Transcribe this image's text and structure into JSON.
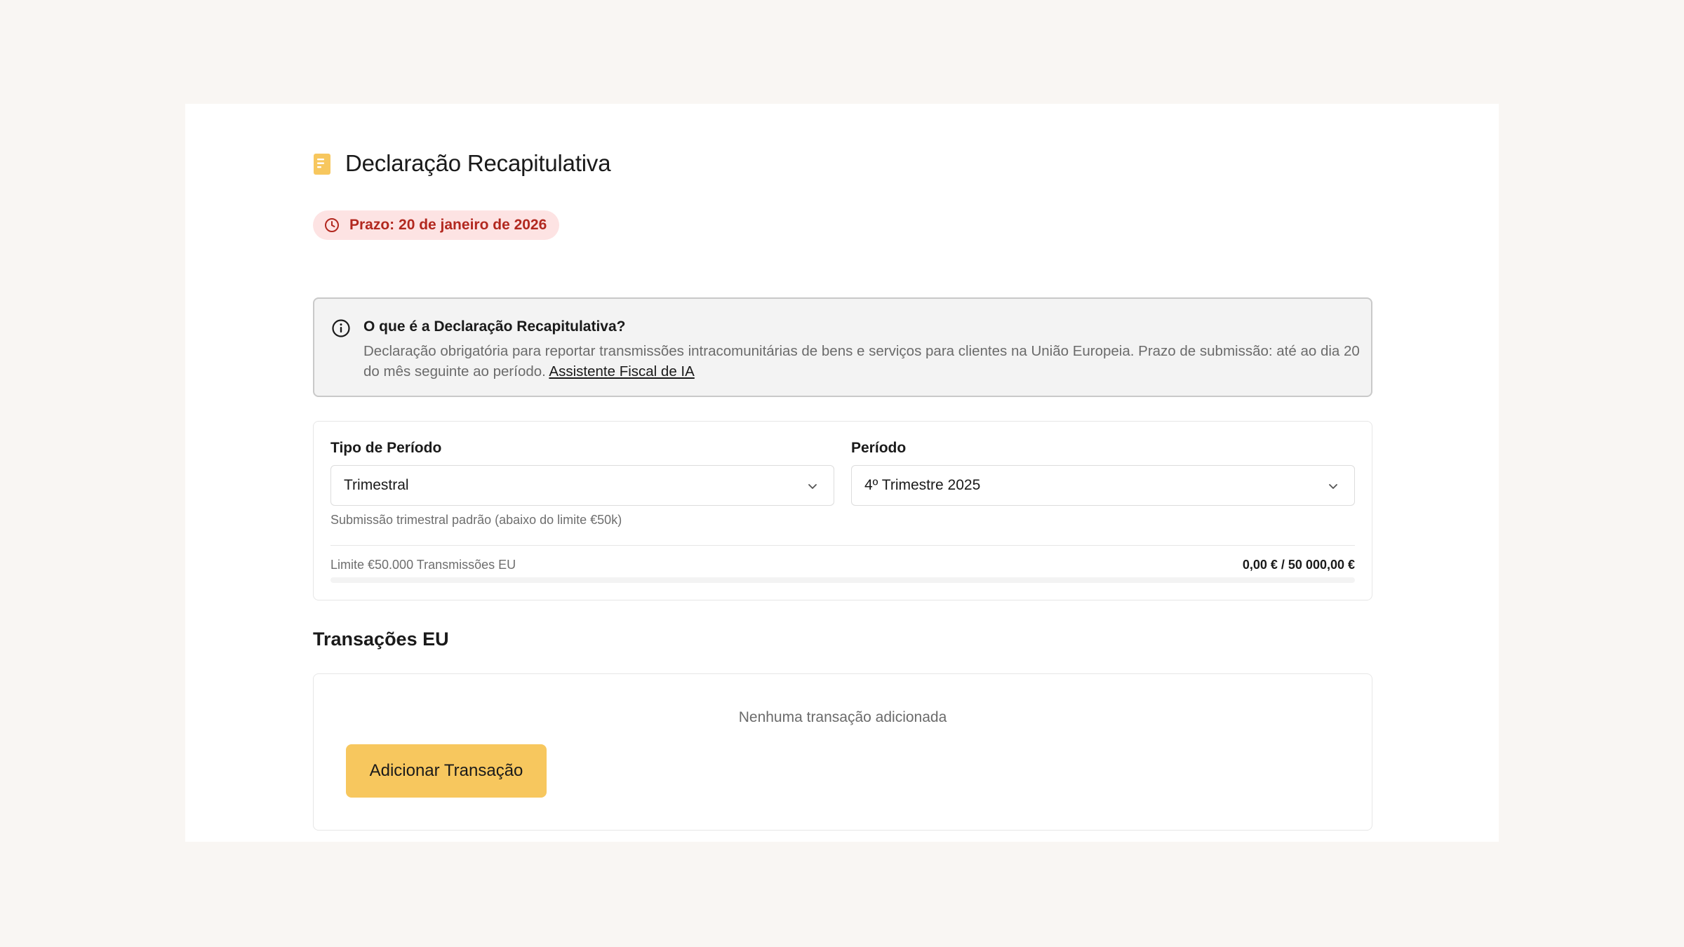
{
  "header": {
    "title": "Declaração Recapitulativa",
    "icon": "document-icon",
    "accent_color": "#f7c75e"
  },
  "deadline": {
    "text": "Prazo: 20 de janeiro de 2026",
    "icon": "clock-icon",
    "color": "#b2281f",
    "background": "#fde3e3"
  },
  "info": {
    "icon": "info-icon",
    "title": "O que é a Declaração Recapitulativa?",
    "description": "Declaração obrigatória para reportar transmissões intracomunitárias de bens e serviços para clientes na União Europeia. Prazo de submissão: até ao dia 20 do mês seguinte ao período.",
    "link_label": "Assistente Fiscal de IA"
  },
  "period": {
    "type_label": "Tipo de Período",
    "type_value": "Trimestral",
    "period_label": "Período",
    "period_value": "4º Trimestre 2025",
    "hint": "Submissão trimestral padrão (abaixo do limite €50k)",
    "limit_label": "Limite €50.000 Transmissões EU",
    "limit_value": "0,00 € / 50 000,00 €",
    "limit_progress": 0
  },
  "transactions": {
    "section_title": "Transações EU",
    "empty_text": "Nenhuma transação adicionada",
    "add_button_label": "Adicionar Transação"
  }
}
